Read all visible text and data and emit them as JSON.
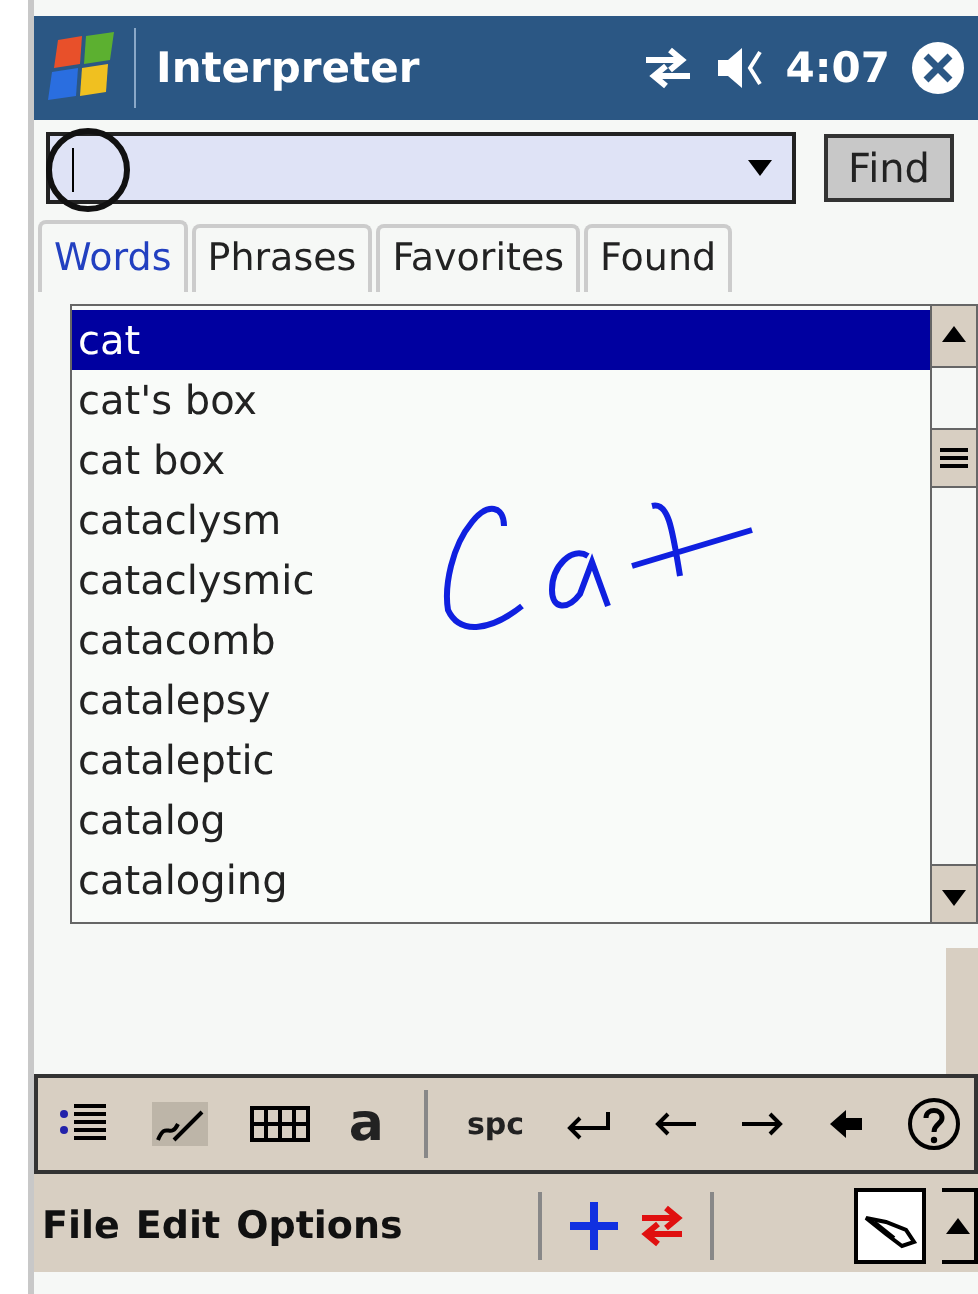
{
  "title_bar": {
    "title": "Interpreter",
    "time": "4:07"
  },
  "search": {
    "button": "Find"
  },
  "tabs": [
    {
      "label": "Words",
      "selected": true
    },
    {
      "label": "Phrases",
      "selected": false
    },
    {
      "label": "Favorites",
      "selected": false
    },
    {
      "label": "Found",
      "selected": false
    }
  ],
  "word_list": [
    {
      "text": "cat",
      "selected": true
    },
    {
      "text": "cat's box",
      "selected": false
    },
    {
      "text": "cat box",
      "selected": false
    },
    {
      "text": "cataclysm",
      "selected": false
    },
    {
      "text": "cataclysmic",
      "selected": false
    },
    {
      "text": "catacomb",
      "selected": false
    },
    {
      "text": "catalepsy",
      "selected": false
    },
    {
      "text": "cataleptic",
      "selected": false
    },
    {
      "text": "catalog",
      "selected": false
    },
    {
      "text": "cataloging",
      "selected": false
    }
  ],
  "input_toolbar": {
    "space_key": "spc",
    "letter_key": "a"
  },
  "menu_bar": [
    "File",
    "Edit",
    "Options"
  ]
}
